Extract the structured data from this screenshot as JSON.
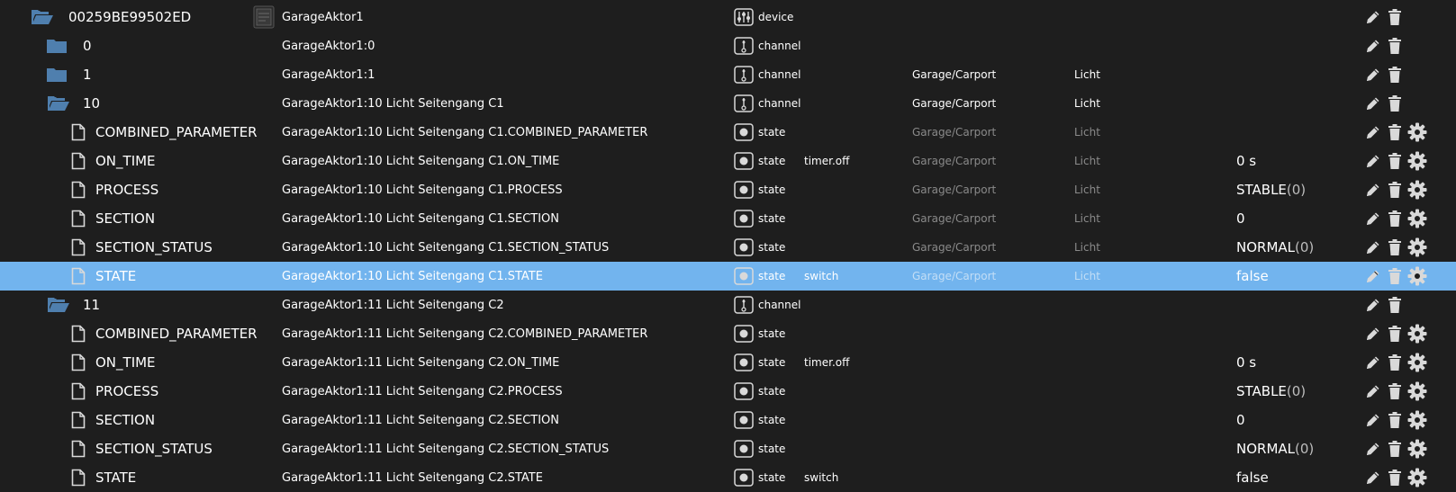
{
  "colors": {
    "background": "#1e1e1e",
    "selected_row": "#72b4ee",
    "folder": "#4f7fae",
    "icon_light": "#d9d9d9",
    "dim_text": "#8a8a8a"
  },
  "rows": [
    {
      "kind": "device",
      "id": "00259BE99502ED",
      "name": "GarageAktor1",
      "type": "device",
      "icon": "folder-open-icon"
    },
    {
      "kind": "channel-closed",
      "id": "0",
      "name": "GarageAktor1:0",
      "type": "channel",
      "icon": "folder-icon"
    },
    {
      "kind": "channel-closed",
      "id": "1",
      "name": "GarageAktor1:1",
      "type": "channel",
      "room": "Garage/Carport",
      "function": "Licht",
      "icon": "folder-icon"
    },
    {
      "kind": "channel-open",
      "id": "10",
      "name": "GarageAktor1:10 Licht Seitengang C1",
      "type": "channel",
      "room": "Garage/Carport",
      "function": "Licht",
      "icon": "folder-open-icon"
    },
    {
      "kind": "state",
      "id": "COMBINED_PARAMETER",
      "name": "GarageAktor1:10 Licht Seitengang C1.COMBINED_PARAMETER",
      "type": "state",
      "room": "Garage/Carport",
      "function": "Licht",
      "icon": "file-icon"
    },
    {
      "kind": "state",
      "id": "ON_TIME",
      "name": "GarageAktor1:10 Licht Seitengang C1.ON_TIME",
      "type": "state",
      "role": "timer.off",
      "room": "Garage/Carport",
      "function": "Licht",
      "value": "0 s",
      "icon": "file-icon"
    },
    {
      "kind": "state",
      "id": "PROCESS",
      "name": "GarageAktor1:10 Licht Seitengang C1.PROCESS",
      "type": "state",
      "room": "Garage/Carport",
      "function": "Licht",
      "value": "STABLE",
      "value_suffix": "(0)",
      "icon": "file-icon"
    },
    {
      "kind": "state",
      "id": "SECTION",
      "name": "GarageAktor1:10 Licht Seitengang C1.SECTION",
      "type": "state",
      "room": "Garage/Carport",
      "function": "Licht",
      "value": "0",
      "icon": "file-icon"
    },
    {
      "kind": "state",
      "id": "SECTION_STATUS",
      "name": "GarageAktor1:10 Licht Seitengang C1.SECTION_STATUS",
      "type": "state",
      "room": "Garage/Carport",
      "function": "Licht",
      "value": "NORMAL",
      "value_suffix": "(0)",
      "icon": "file-icon"
    },
    {
      "kind": "state",
      "id": "STATE",
      "name": "GarageAktor1:10 Licht Seitengang C1.STATE",
      "type": "state",
      "role": "switch",
      "room": "Garage/Carport",
      "function": "Licht",
      "value": "false",
      "selected": true,
      "icon": "file-icon"
    },
    {
      "kind": "channel-open",
      "id": "11",
      "name": "GarageAktor1:11 Licht Seitengang C2",
      "type": "channel",
      "icon": "folder-open-icon"
    },
    {
      "kind": "state",
      "id": "COMBINED_PARAMETER",
      "name": "GarageAktor1:11 Licht Seitengang C2.COMBINED_PARAMETER",
      "type": "state",
      "icon": "file-icon"
    },
    {
      "kind": "state",
      "id": "ON_TIME",
      "name": "GarageAktor1:11 Licht Seitengang C2.ON_TIME",
      "type": "state",
      "role": "timer.off",
      "value": "0 s",
      "icon": "file-icon"
    },
    {
      "kind": "state",
      "id": "PROCESS",
      "name": "GarageAktor1:11 Licht Seitengang C2.PROCESS",
      "type": "state",
      "value": "STABLE",
      "value_suffix": "(0)",
      "icon": "file-icon"
    },
    {
      "kind": "state",
      "id": "SECTION",
      "name": "GarageAktor1:11 Licht Seitengang C2.SECTION",
      "type": "state",
      "value": "0",
      "icon": "file-icon"
    },
    {
      "kind": "state",
      "id": "SECTION_STATUS",
      "name": "GarageAktor1:11 Licht Seitengang C2.SECTION_STATUS",
      "type": "state",
      "value": "NORMAL",
      "value_suffix": "(0)",
      "icon": "file-icon"
    },
    {
      "kind": "state",
      "id": "STATE",
      "name": "GarageAktor1:11 Licht Seitengang C2.STATE",
      "type": "state",
      "role": "switch",
      "value": "false",
      "icon": "file-icon"
    }
  ]
}
